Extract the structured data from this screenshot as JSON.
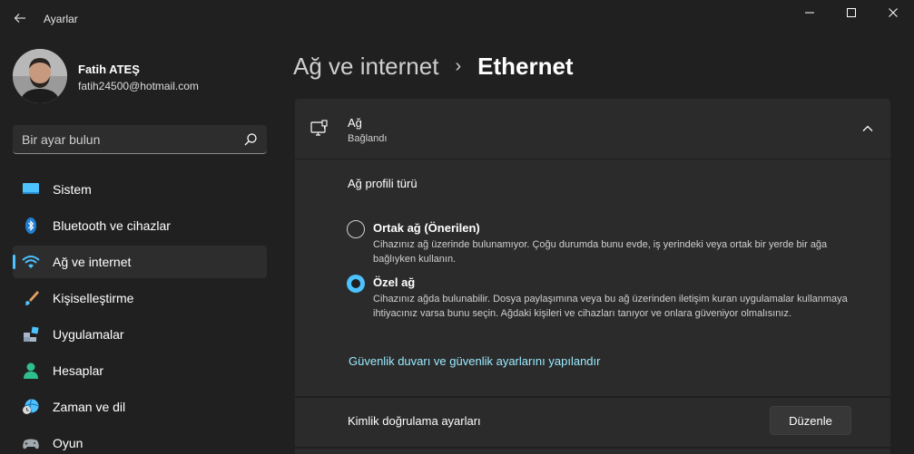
{
  "window": {
    "title": "Ayarlar"
  },
  "user": {
    "name": "Fatih ATEŞ",
    "email": "fatih24500@hotmail.com"
  },
  "search": {
    "placeholder": "Bir ayar bulun"
  },
  "sidebar": {
    "items": [
      {
        "label": "Sistem",
        "icon": "monitor-icon"
      },
      {
        "label": "Bluetooth ve cihazlar",
        "icon": "bluetooth-icon"
      },
      {
        "label": "Ağ ve internet",
        "icon": "wifi-icon",
        "active": true
      },
      {
        "label": "Kişiselleştirme",
        "icon": "paintbrush-icon"
      },
      {
        "label": "Uygulamalar",
        "icon": "apps-icon"
      },
      {
        "label": "Hesaplar",
        "icon": "person-icon"
      },
      {
        "label": "Zaman ve dil",
        "icon": "globe-clock-icon"
      },
      {
        "label": "Oyun",
        "icon": "gamepad-icon"
      }
    ]
  },
  "breadcrumb": {
    "parent": "Ağ ve internet",
    "separator": "›",
    "current": "Ethernet"
  },
  "network_card": {
    "title": "Ağ",
    "status": "Bağlandı",
    "profile_type_label": "Ağ profili türü",
    "options": [
      {
        "title": "Ortak ağ (Önerilen)",
        "description": "Cihazınız ağ üzerinde bulunamıyor. Çoğu durumda bunu evde, iş yerindeki veya ortak bir yerde bir ağa bağlıyken kullanın.",
        "selected": false
      },
      {
        "title": "Özel ağ",
        "description": "Cihazınız ağda bulunabilir. Dosya paylaşımına veya bu ağ üzerinden iletişim kuran uygulamalar kullanmaya ihtiyacınız varsa bunu seçin. Ağdaki kişileri ve cihazları tanıyor ve onlara güveniyor olmalısınız.",
        "selected": true
      }
    ],
    "firewall_link": "Güvenlik duvarı ve güvenlik ayarlarını yapılandır"
  },
  "auth_card": {
    "label": "Kimlik doğrulama ayarları",
    "button": "Düzenle"
  },
  "colors": {
    "background": "#202020",
    "card": "#2b2b2b",
    "accent": "#4cc2ff",
    "link": "#99ebff"
  }
}
